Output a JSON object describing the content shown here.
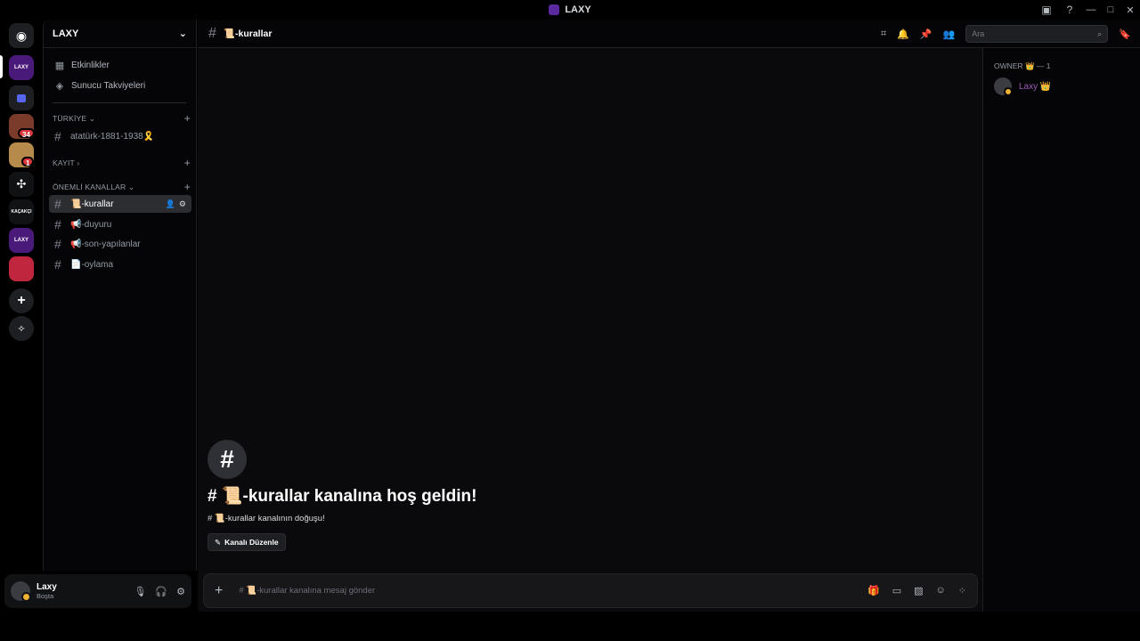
{
  "window": {
    "title": "LAXY",
    "icons": [
      "inbox-icon",
      "help-icon"
    ],
    "controls": [
      "minimize",
      "maximize",
      "close"
    ]
  },
  "rail": {
    "home": "discord-home-icon",
    "servers": [
      {
        "label": "LAXY",
        "color": "#4a1a7a",
        "active": true
      },
      {
        "label": "",
        "color": "#5865f2",
        "folder": true
      },
      {
        "label": "",
        "color": "#7a3b2a",
        "badge": "34"
      },
      {
        "label": "",
        "color": "#b58a4a",
        "badge": "1"
      },
      {
        "label": "✣",
        "color": "#111214"
      },
      {
        "label": "KAÇAKÇI",
        "color": "#111214"
      },
      {
        "label": "LAXY",
        "color": "#4a1a7a"
      },
      {
        "label": "",
        "color": "#c0263e"
      }
    ],
    "add_server": "add-server-icon",
    "explore": "explore-icon"
  },
  "sidebar": {
    "guild_name": "LAXY",
    "top_items": [
      {
        "label": "Etkinlikler",
        "icon": "calendar-icon"
      },
      {
        "label": "Sunucu Takviyeleri",
        "icon": "boost-icon"
      }
    ],
    "categories": [
      {
        "name": "TÜRKİYE",
        "chevron": "⌄"
      },
      {
        "name": "KAYIT",
        "chevron": "›"
      },
      {
        "name": "ÖNEMLİ KANALLAR",
        "chevron": "⌄"
      }
    ],
    "channels": {
      "turkiye": "atatürk-1881-1938🎗️",
      "important": [
        {
          "label": "📜-kurallar",
          "active": true
        },
        {
          "label": "📢-duyuru"
        },
        {
          "label": "📢-son-yapılanlar"
        },
        {
          "label": "📄-oylama"
        }
      ]
    }
  },
  "user": {
    "name": "Laxy",
    "status": "Boşta"
  },
  "header": {
    "channel": "📜-kurallar",
    "search_placeholder": "Ara"
  },
  "welcome": {
    "title": "# 📜-kurallar kanalına hoş geldin!",
    "subtitle": "# 📜-kurallar kanalının doğuşu!",
    "edit_button": "Kanalı Düzenle"
  },
  "composer": {
    "placeholder": "# 📜-kurallar kanalına mesaj gönder"
  },
  "members": {
    "group": "OWNER 👑 — 1",
    "list": [
      {
        "name": "Laxy 👑"
      }
    ]
  }
}
